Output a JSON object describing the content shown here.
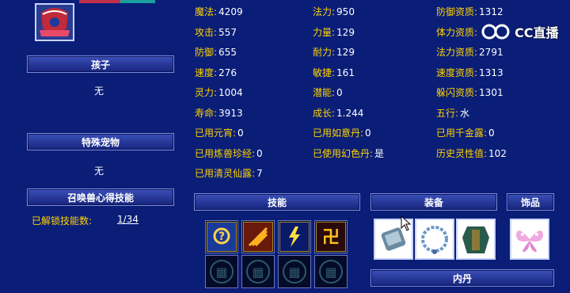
{
  "stats": [
    {
      "label": "魔法:",
      "value": "4209"
    },
    {
      "label": "法力:",
      "value": "950"
    },
    {
      "label": "防御资质:",
      "value": "1312"
    },
    {
      "label": "攻击:",
      "value": "557"
    },
    {
      "label": "力量:",
      "value": "129"
    },
    {
      "label": "体力资质:",
      "value": ""
    },
    {
      "label": "防御:",
      "value": "655"
    },
    {
      "label": "耐力:",
      "value": "129"
    },
    {
      "label": "法力资质:",
      "value": "2791"
    },
    {
      "label": "速度:",
      "value": "276"
    },
    {
      "label": "敏捷:",
      "value": "161"
    },
    {
      "label": "速度资质:",
      "value": "1313"
    },
    {
      "label": "灵力:",
      "value": "1004"
    },
    {
      "label": "潜能:",
      "value": "0"
    },
    {
      "label": "躲闪资质:",
      "value": "1301"
    },
    {
      "label": "寿命:",
      "value": "3913"
    },
    {
      "label": "成长:",
      "value": "1.244"
    },
    {
      "label": "五行:",
      "value": "水"
    },
    {
      "label": "已用元宵:",
      "value": "0"
    },
    {
      "label": "已用如意丹:",
      "value": "0"
    },
    {
      "label": "已用千金露:",
      "value": "0"
    },
    {
      "label": "已用炼兽珍经:",
      "value": "0"
    },
    {
      "label": "已使用幻色丹:",
      "value": "是"
    },
    {
      "label": "历史灵性值:",
      "value": "102"
    },
    {
      "label": "已用清灵仙露:",
      "value": "7"
    }
  ],
  "left": {
    "child_header": "孩子",
    "child_value": "无",
    "special_pet_header": "特殊宠物",
    "special_pet_value": "无",
    "insight_header": "召唤兽心得技能",
    "unlocked_label": "已解锁技能数:",
    "unlocked_value": "1/34"
  },
  "sections": {
    "skills": "技能",
    "equipment": "装备",
    "accessory": "饰品",
    "inner_dan": "内丹"
  },
  "skills": [
    {
      "icon": "question-hand-icon",
      "glyph": "?"
    },
    {
      "icon": "fire-claw-icon",
      "glyph": "⟋"
    },
    {
      "icon": "lightning-icon",
      "glyph": "⚡"
    },
    {
      "icon": "rune-icon",
      "glyph": "卍"
    }
  ],
  "equipment": [
    {
      "icon": "armor-piece-icon"
    },
    {
      "icon": "chain-ring-icon"
    },
    {
      "icon": "robe-icon"
    }
  ],
  "accessory": {
    "icon": "butterfly-wing-icon"
  },
  "watermark": "CC直播",
  "colors": {
    "background": "#0a1e78",
    "label": "#ffd200",
    "value": "#ffffff"
  }
}
